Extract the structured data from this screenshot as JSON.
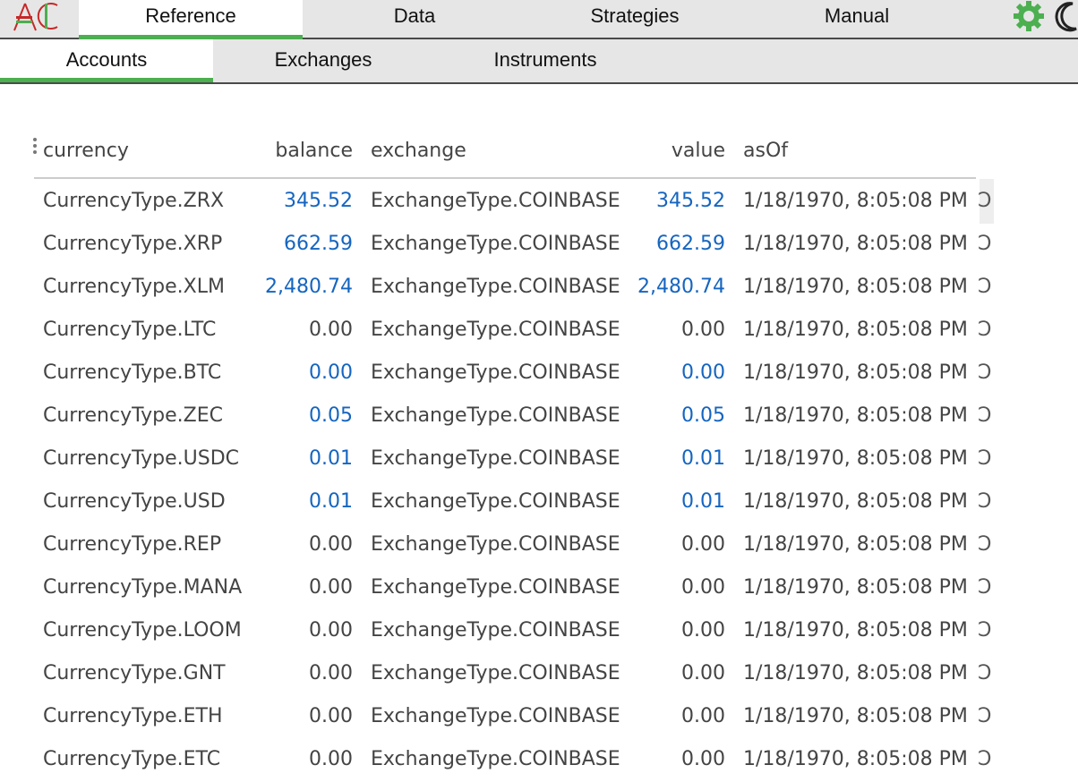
{
  "nav": {
    "tabs": [
      {
        "label": "Reference",
        "active": true
      },
      {
        "label": "Data",
        "active": false
      },
      {
        "label": "Strategies",
        "active": false
      },
      {
        "label": "Manual",
        "active": false
      }
    ],
    "icons": [
      "ac-logo-icon",
      "gear-icon",
      "moon-icon"
    ]
  },
  "subnav": {
    "tabs": [
      {
        "label": "Accounts",
        "active": true
      },
      {
        "label": "Exchanges",
        "active": false
      },
      {
        "label": "Instruments",
        "active": false
      }
    ]
  },
  "table": {
    "columns": [
      "currency",
      "balance",
      "exchange",
      "value",
      "asOf"
    ],
    "rows": [
      {
        "currency": "CurrencyType.ZRX",
        "balance": "345.52",
        "exchange": "ExchangeType.COINBASE",
        "value": "345.52",
        "asOf": "1/18/1970, 8:05:08 PM",
        "highlight": true
      },
      {
        "currency": "CurrencyType.XRP",
        "balance": "662.59",
        "exchange": "ExchangeType.COINBASE",
        "value": "662.59",
        "asOf": "1/18/1970, 8:05:08 PM",
        "highlight": true
      },
      {
        "currency": "CurrencyType.XLM",
        "balance": "2,480.74",
        "exchange": "ExchangeType.COINBASE",
        "value": "2,480.74",
        "asOf": "1/18/1970, 8:05:08 PM",
        "highlight": true
      },
      {
        "currency": "CurrencyType.LTC",
        "balance": "0.00",
        "exchange": "ExchangeType.COINBASE",
        "value": "0.00",
        "asOf": "1/18/1970, 8:05:08 PM",
        "highlight": false
      },
      {
        "currency": "CurrencyType.BTC",
        "balance": "0.00",
        "exchange": "ExchangeType.COINBASE",
        "value": "0.00",
        "asOf": "1/18/1970, 8:05:08 PM",
        "highlight": true
      },
      {
        "currency": "CurrencyType.ZEC",
        "balance": "0.05",
        "exchange": "ExchangeType.COINBASE",
        "value": "0.05",
        "asOf": "1/18/1970, 8:05:08 PM",
        "highlight": true
      },
      {
        "currency": "CurrencyType.USDC",
        "balance": "0.01",
        "exchange": "ExchangeType.COINBASE",
        "value": "0.01",
        "asOf": "1/18/1970, 8:05:08 PM",
        "highlight": true
      },
      {
        "currency": "CurrencyType.USD",
        "balance": "0.01",
        "exchange": "ExchangeType.COINBASE",
        "value": "0.01",
        "asOf": "1/18/1970, 8:05:08 PM",
        "highlight": true
      },
      {
        "currency": "CurrencyType.REP",
        "balance": "0.00",
        "exchange": "ExchangeType.COINBASE",
        "value": "0.00",
        "asOf": "1/18/1970, 8:05:08 PM",
        "highlight": false
      },
      {
        "currency": "CurrencyType.MANA",
        "balance": "0.00",
        "exchange": "ExchangeType.COINBASE",
        "value": "0.00",
        "asOf": "1/18/1970, 8:05:08 PM",
        "highlight": false
      },
      {
        "currency": "CurrencyType.LOOM",
        "balance": "0.00",
        "exchange": "ExchangeType.COINBASE",
        "value": "0.00",
        "asOf": "1/18/1970, 8:05:08 PM",
        "highlight": false
      },
      {
        "currency": "CurrencyType.GNT",
        "balance": "0.00",
        "exchange": "ExchangeType.COINBASE",
        "value": "0.00",
        "asOf": "1/18/1970, 8:05:08 PM",
        "highlight": false
      },
      {
        "currency": "CurrencyType.ETH",
        "balance": "0.00",
        "exchange": "ExchangeType.COINBASE",
        "value": "0.00",
        "asOf": "1/18/1970, 8:05:08 PM",
        "highlight": false
      },
      {
        "currency": "CurrencyType.ETC",
        "balance": "0.00",
        "exchange": "ExchangeType.COINBASE",
        "value": "0.00",
        "asOf": "1/18/1970, 8:05:08 PM",
        "highlight": false
      }
    ]
  },
  "colors": {
    "accent": "#4caf50",
    "positive_value": "#1565c0",
    "nav_background": "#e6e6e6"
  }
}
